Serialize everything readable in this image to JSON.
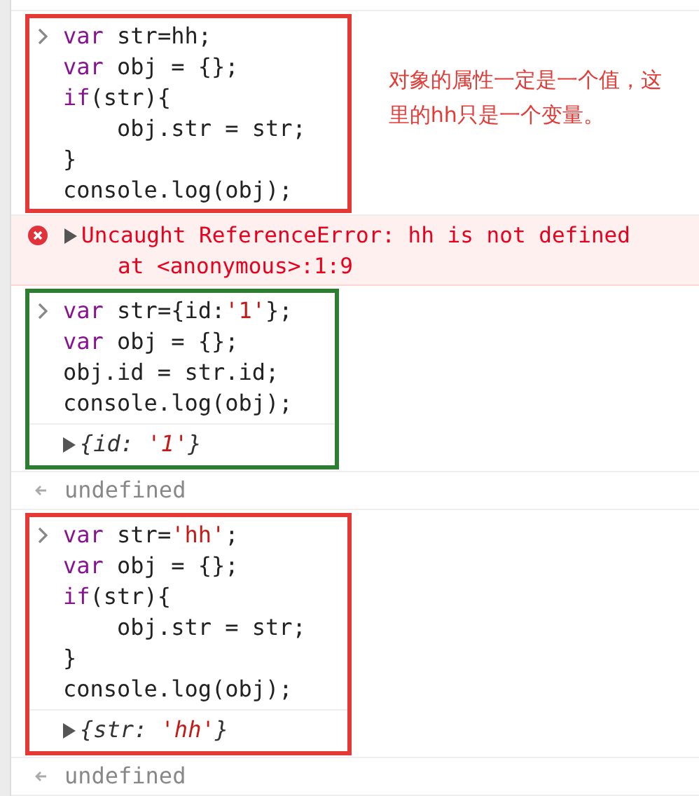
{
  "entries": [
    {
      "kind": "group",
      "color": "#e53935",
      "note": "对象的属性一定是一个值，这里的hh只是一个变量。",
      "items": [
        {
          "kind": "input",
          "lines": [
            [
              {
                "kind": "keyword",
                "s": "var"
              },
              {
                "kind": "plain",
                "s": " str=hh;"
              }
            ],
            [
              {
                "kind": "keyword",
                "s": "var"
              },
              {
                "kind": "plain",
                "s": " obj = {};"
              }
            ],
            [
              {
                "kind": "keyword",
                "s": "if"
              },
              {
                "kind": "plain",
                "s": "(str){"
              }
            ],
            [
              {
                "kind": "plain",
                "s": "    obj.str = str;"
              }
            ],
            [
              {
                "kind": "plain",
                "s": "}"
              }
            ],
            [
              {
                "kind": "plain",
                "s": "console.log(obj);"
              }
            ]
          ]
        }
      ]
    },
    {
      "kind": "error",
      "message": "Uncaught ReferenceError: hh is not defined",
      "location": "at <anonymous>:1:9"
    },
    {
      "kind": "group",
      "color": "#2e7d32",
      "items": [
        {
          "kind": "input",
          "lines": [
            [
              {
                "kind": "keyword",
                "s": "var"
              },
              {
                "kind": "plain",
                "s": " str={id:"
              },
              {
                "kind": "string",
                "s": "'1'"
              },
              {
                "kind": "plain",
                "s": "};"
              }
            ],
            [
              {
                "kind": "keyword",
                "s": "var"
              },
              {
                "kind": "plain",
                "s": " obj = {};"
              }
            ],
            [
              {
                "kind": "plain",
                "s": "obj.id = str.id;"
              }
            ],
            [
              {
                "kind": "plain",
                "s": "console.log(obj);"
              }
            ]
          ]
        },
        {
          "kind": "output",
          "tokens": [
            {
              "kind": "plain",
              "s": "{id: "
            },
            {
              "kind": "string",
              "s": "'1'"
            },
            {
              "kind": "plain",
              "s": "}"
            }
          ]
        }
      ]
    },
    {
      "kind": "return",
      "value": "undefined"
    },
    {
      "kind": "group",
      "color": "#e53935",
      "items": [
        {
          "kind": "input",
          "lines": [
            [
              {
                "kind": "keyword",
                "s": "var"
              },
              {
                "kind": "plain",
                "s": " str="
              },
              {
                "kind": "string",
                "s": "'hh'"
              },
              {
                "kind": "plain",
                "s": ";"
              }
            ],
            [
              {
                "kind": "keyword",
                "s": "var"
              },
              {
                "kind": "plain",
                "s": " obj = {};"
              }
            ],
            [
              {
                "kind": "keyword",
                "s": "if"
              },
              {
                "kind": "plain",
                "s": "(str){"
              }
            ],
            [
              {
                "kind": "plain",
                "s": "    obj.str = str;"
              }
            ],
            [
              {
                "kind": "plain",
                "s": "}"
              }
            ],
            [
              {
                "kind": "plain",
                "s": "console.log(obj);"
              }
            ]
          ]
        },
        {
          "kind": "output",
          "tokens": [
            {
              "kind": "plain",
              "s": "{str: "
            },
            {
              "kind": "string",
              "s": "'hh'"
            },
            {
              "kind": "plain",
              "s": "}"
            }
          ]
        }
      ]
    },
    {
      "kind": "return",
      "value": "undefined"
    }
  ]
}
